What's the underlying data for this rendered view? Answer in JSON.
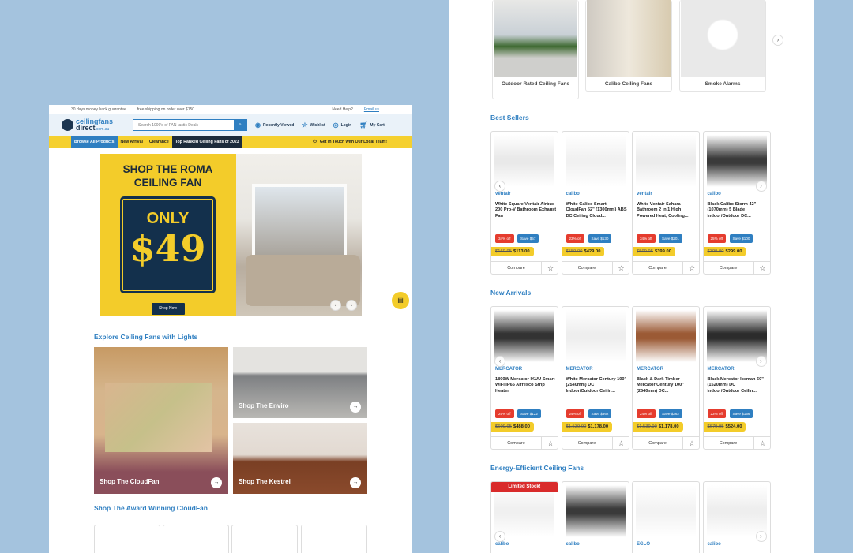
{
  "topbar": {
    "guarantee": "30 days money back guarantee",
    "shipping": "free shipping on order over $150",
    "help": "Need Help?",
    "email": "Email us"
  },
  "header": {
    "logo_top": "ceilingfans",
    "logo_bottom": "direct",
    "logo_domain": ".com.au",
    "search_placeholder": "Search 1000's of FAN-tastic Deals",
    "recently_viewed": "Recently Viewed",
    "wishlist": "Wishlist",
    "login": "Login",
    "cart": "My Cart"
  },
  "nav": {
    "browse": "Browse All Products",
    "new_arrival": "New Arrival",
    "clearance": "Clearance",
    "top_ranked": "Top Ranked Ceiling Fans of 2023",
    "contact": "Get in Touch with Our Local Team!"
  },
  "banner": {
    "title1": "SHOP THE ROMA",
    "title2": "CEILING FAN",
    "only": "ONLY",
    "price": "$49",
    "cta": "Shop Now"
  },
  "explore": {
    "title": "Explore Ceiling Fans with Lights",
    "tiles": [
      "Shop The CloudFan",
      "Shop The Enviro",
      "Shop The Kestrel"
    ]
  },
  "award": {
    "title": "Shop The Award Winning CloudFan"
  },
  "categories": [
    "Outdoor Rated Ceiling Fans",
    "Calibo Ceiling Fans",
    "Smoke Alarms"
  ],
  "sections": [
    {
      "title": "Best Sellers",
      "products": [
        {
          "brand": "ventair",
          "name": "White Square Ventair Airbus 200 Pro-V Bathroom Exhaust Fan",
          "off": "34% off",
          "save": "Save $57",
          "was": "$169.95",
          "price": "$113.00",
          "compare": "Compare",
          "img": "#e9e9e9"
        },
        {
          "brand": "calibo",
          "name": "White Calibo Smart CloudFan 52\" (1300mm) ABS DC Ceiling Cloud...",
          "off": "23% off",
          "save": "Save $130",
          "was": "$559.00",
          "price": "$429.00",
          "compare": "Compare",
          "img": "#f1f1f1"
        },
        {
          "brand": "ventair",
          "name": "White Ventair Sahara Bathroom 2 in 1 High Powered Heat, Cooling...",
          "off": "34% off",
          "save": "Save $201",
          "was": "$599.95",
          "price": "$399.00",
          "compare": "Compare",
          "img": "#ececec"
        },
        {
          "brand": "calibo",
          "name": "Black Calibo Storm 42\" (1070mm) 5 Blade Indoor/Outdoor DC...",
          "off": "25% off",
          "save": "Save $100",
          "was": "$399.00",
          "price": "$299.00",
          "compare": "Compare",
          "img": "#3a3a3a"
        }
      ]
    },
    {
      "title": "New Arrivals",
      "products": [
        {
          "brand": "MERCATOR",
          "name": "1800W Mercator IKUU Smart WiFi IP65 Alfresco Strip Heater",
          "off": "25% off",
          "save": "Save $122",
          "was": "$609.95",
          "price": "$488.00",
          "compare": "Compare",
          "img": "#333"
        },
        {
          "brand": "MERCATOR",
          "name": "White Mercator Century 100\" (2540mm) DC Indoor/Outdoor Ceilin...",
          "off": "24% off",
          "save": "Save $362",
          "was": "$1,539.90",
          "price": "$1,178.00",
          "compare": "Compare",
          "img": "#eee"
        },
        {
          "brand": "MERCATOR",
          "name": "Black & Dark Timber Mercator Century 100\" (2540mm) DC...",
          "off": "24% off",
          "save": "Save $362",
          "was": "$1,539.90",
          "price": "$1,178.00",
          "compare": "Compare",
          "img": "#9b5a35"
        },
        {
          "brand": "MERCATOR",
          "name": "Black Mercator Iceman 60\" (1520mm) DC Indoor/Outdoor Ceilin...",
          "off": "23% off",
          "save": "Save $156",
          "was": "$679.95",
          "price": "$524.00",
          "compare": "Compare",
          "img": "#2c2c2c"
        }
      ]
    },
    {
      "title": "Energy-Efficient Ceiling Fans",
      "products": [
        {
          "badge": "Limited Stock!",
          "brand": "calibo",
          "img": "#f0f0f0"
        },
        {
          "brand": "calibo",
          "img": "#3a3a3a"
        },
        {
          "brand": "EGLO",
          "img": "#f3f3f3"
        },
        {
          "brand": "calibo",
          "img": "#eeeeee"
        }
      ]
    }
  ],
  "colors": {
    "accent": "#2f7fc1",
    "yellow": "#f3cc2a",
    "navy": "#13304c",
    "sale": "#e53c2e",
    "background": "#a4c3de"
  }
}
